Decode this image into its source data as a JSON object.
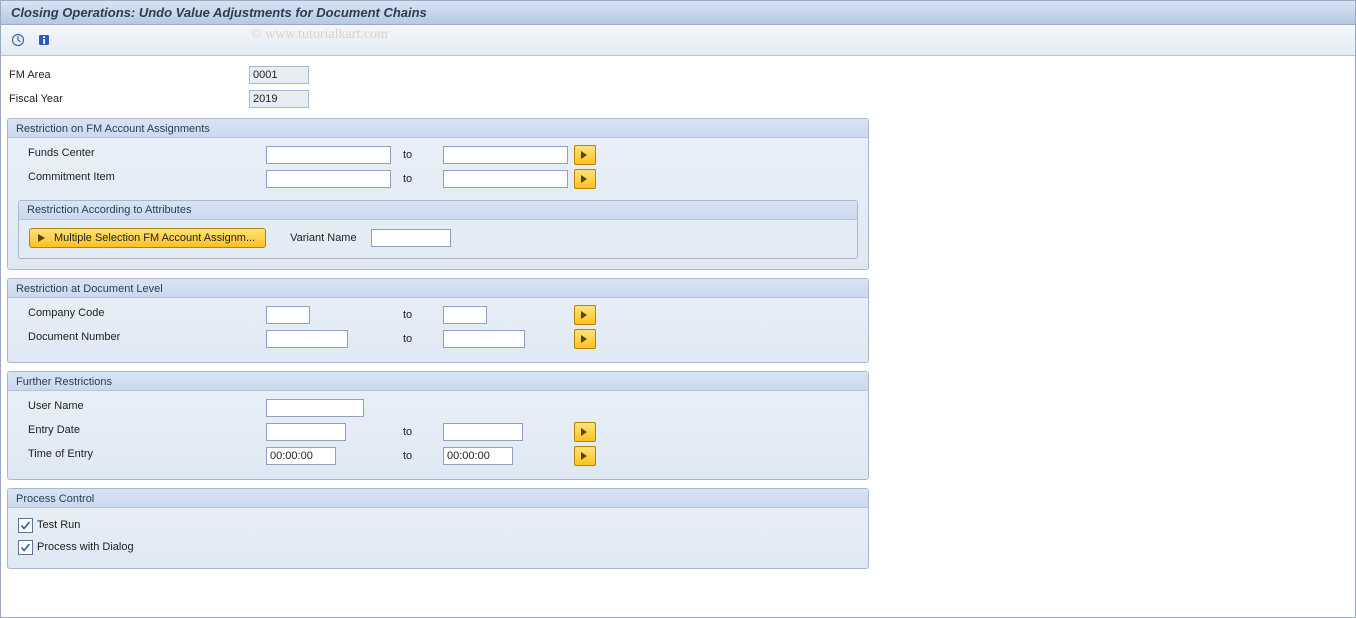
{
  "title": "Closing Operations: Undo Value Adjustments for Document Chains",
  "watermark": "© www.tutorialkart.com",
  "header": {
    "fm_area_label": "FM Area",
    "fm_area_value": "0001",
    "fiscal_year_label": "Fiscal Year",
    "fiscal_year_value": "2019"
  },
  "group1": {
    "legend": "Restriction on FM Account Assignments",
    "funds_center_label": "Funds Center",
    "commitment_item_label": "Commitment Item",
    "to": "to",
    "sub_legend": "Restriction According to Attributes",
    "ms_btn": "Multiple Selection FM Account Assignm...",
    "variant_label": "Variant Name"
  },
  "group2": {
    "legend": "Restriction at Document Level",
    "company_code_label": "Company Code",
    "document_number_label": "Document Number",
    "to": "to"
  },
  "group3": {
    "legend": "Further Restrictions",
    "user_name_label": "User Name",
    "entry_date_label": "Entry Date",
    "time_of_entry_label": "Time of Entry",
    "to": "to",
    "time_from": "00:00:00",
    "time_to": "00:00:00"
  },
  "group4": {
    "legend": "Process Control",
    "test_run_label": "Test Run",
    "process_dialog_label": "Process with Dialog"
  }
}
